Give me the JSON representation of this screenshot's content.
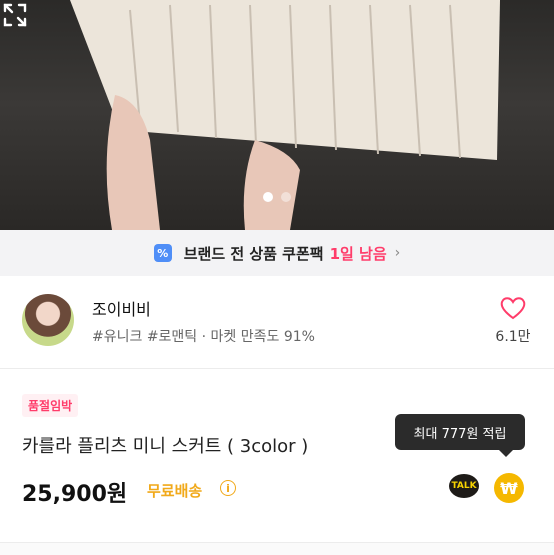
{
  "hero": {
    "page_count": 2,
    "active_index": 0
  },
  "coupon_banner": {
    "icon": "%",
    "title": "브랜드 전 상품 쿠폰팩",
    "remaining": "1일 남음",
    "chevron": "›"
  },
  "seller": {
    "name": "조이비비",
    "tags": "#유니크 #로맨틱 · 마켓 만족도 91%",
    "likes": "6.1만"
  },
  "product": {
    "badge": "품절임박",
    "name": "카를라 플리츠 미니 스커트 ( 3color )",
    "price": "25,900원",
    "shipping": "무료배송",
    "info_icon": "i"
  },
  "tooltip": {
    "text": "최대 777원 적립"
  },
  "actions": {
    "talk_label": "TALK",
    "coin_symbol": "₩"
  },
  "colors": {
    "accent_pink": "#ff3c6a",
    "shipping_yellow": "#f1a91a",
    "coin": "#f5b800",
    "coupon_blue": "#4f8ef7"
  }
}
